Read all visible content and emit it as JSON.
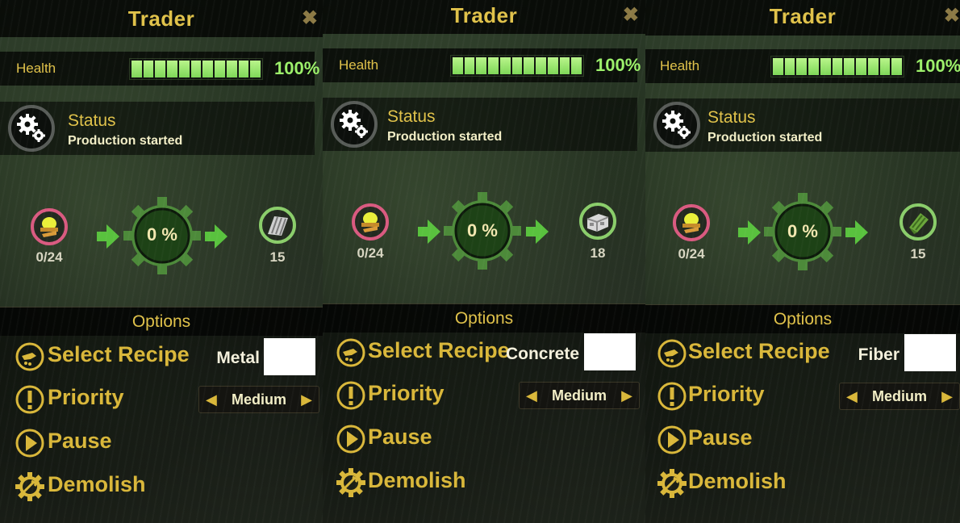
{
  "colors": {
    "accent_gold": "#e0c24a",
    "health_green": "#9cf06a",
    "input_ring": "#d95a80",
    "output_ring": "#8acd6a",
    "gear_green": "#4d8a3a"
  },
  "panels": [
    {
      "title": "Trader",
      "close_icon": "close-x-icon",
      "health": {
        "label": "Health",
        "percent": 100,
        "percent_text": "100%"
      },
      "status": {
        "title": "Status",
        "text": "Production started",
        "icon": "gears-icon"
      },
      "production": {
        "input_count": "0/24",
        "input_icon": "worker-helmet-icon",
        "progress_text": "0 %",
        "progress": 0,
        "output_count": "15",
        "output_icon": "metal-sheet-icon"
      },
      "options": {
        "title": "Options",
        "select_recipe": "Select Recipe",
        "recipe_value": "Metal",
        "priority": "Priority",
        "priority_value": "Medium",
        "pause": "Pause",
        "demolish": "Demolish"
      }
    },
    {
      "title": "Trader",
      "close_icon": "close-x-icon",
      "health": {
        "label": "Health",
        "percent": 100,
        "percent_text": "100%"
      },
      "status": {
        "title": "Status",
        "text": "Production started",
        "icon": "gears-icon"
      },
      "production": {
        "input_count": "0/24",
        "input_icon": "worker-helmet-icon",
        "progress_text": "0 %",
        "progress": 0,
        "output_count": "18",
        "output_icon": "concrete-block-icon"
      },
      "options": {
        "title": "Options",
        "select_recipe": "Select Recipe",
        "recipe_value": "Concrete",
        "priority": "Priority",
        "priority_value": "Medium",
        "pause": "Pause",
        "demolish": "Demolish"
      }
    },
    {
      "title": "Trader",
      "close_icon": "close-x-icon",
      "health": {
        "label": "Health",
        "percent": 100,
        "percent_text": "100%"
      },
      "status": {
        "title": "Status",
        "text": "Production started",
        "icon": "gears-icon"
      },
      "production": {
        "input_count": "0/24",
        "input_icon": "worker-helmet-icon",
        "progress_text": "0 %",
        "progress": 0,
        "output_count": "15",
        "output_icon": "fiber-bundle-icon"
      },
      "options": {
        "title": "Options",
        "select_recipe": "Select Recipe",
        "recipe_value": "Fiber",
        "priority": "Priority",
        "priority_value": "Medium",
        "pause": "Pause",
        "demolish": "Demolish"
      }
    }
  ]
}
